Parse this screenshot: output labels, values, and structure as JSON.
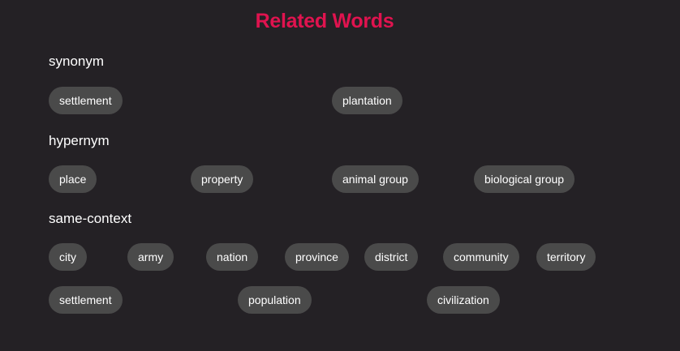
{
  "title": "Related Words",
  "accent_color": "#e0134f",
  "sections": {
    "synonym": {
      "heading": "synonym",
      "words": [
        "settlement",
        "plantation"
      ]
    },
    "hypernym": {
      "heading": "hypernym",
      "words": [
        "place",
        "property",
        "animal group",
        "biological group"
      ]
    },
    "same_context": {
      "heading": "same-context",
      "words": [
        "city",
        "army",
        "nation",
        "province",
        "district",
        "community",
        "territory",
        "settlement",
        "population",
        "civilization"
      ]
    }
  }
}
